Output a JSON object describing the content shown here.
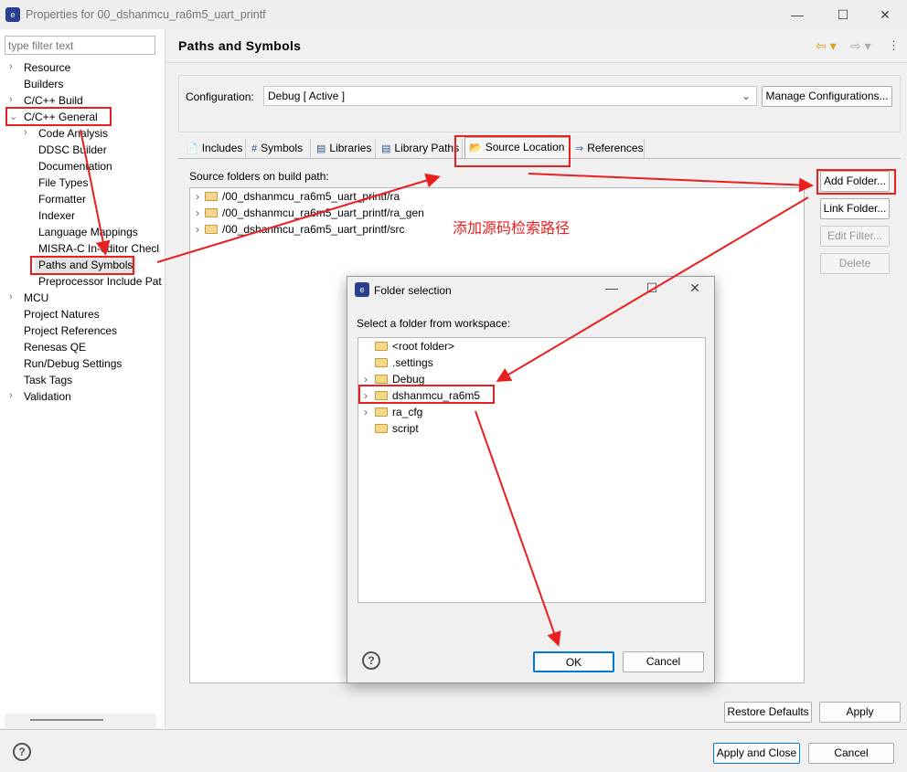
{
  "window": {
    "title": "Properties for 00_dshanmcu_ra6m5_uart_printf",
    "minimize": "—",
    "maximize": "☐",
    "close": "✕"
  },
  "left": {
    "filter_placeholder": "type filter text",
    "tree": [
      {
        "label": "Resource",
        "level": 0,
        "chevron": ">"
      },
      {
        "label": "Builders",
        "level": 0
      },
      {
        "label": "C/C++ Build",
        "level": 0,
        "chevron": ">"
      },
      {
        "label": "C/C++ General",
        "level": 0,
        "chevron": "v"
      },
      {
        "label": "Code Analysis",
        "level": 1,
        "chevron": ">"
      },
      {
        "label": "DDSC Builder",
        "level": 1
      },
      {
        "label": "Documentation",
        "level": 1
      },
      {
        "label": "File Types",
        "level": 1
      },
      {
        "label": "Formatter",
        "level": 1
      },
      {
        "label": "Indexer",
        "level": 1
      },
      {
        "label": "Language Mappings",
        "level": 1
      },
      {
        "label": "MISRA-C In-editor Checl",
        "level": 1
      },
      {
        "label": "Paths and Symbols",
        "level": 1,
        "selected": true
      },
      {
        "label": "Preprocessor Include Pat",
        "level": 1
      },
      {
        "label": "MCU",
        "level": 0,
        "chevron": ">"
      },
      {
        "label": "Project Natures",
        "level": 0
      },
      {
        "label": "Project References",
        "level": 0
      },
      {
        "label": "Renesas QE",
        "level": 0
      },
      {
        "label": "Run/Debug Settings",
        "level": 0
      },
      {
        "label": "Task Tags",
        "level": 0
      },
      {
        "label": "Validation",
        "level": 0,
        "chevron": ">"
      }
    ]
  },
  "page": {
    "title": "Paths and Symbols",
    "config_label": "Configuration:",
    "config_value": "Debug  [ Active ]",
    "manage_button": "Manage Configurations...",
    "tabs": [
      "Includes",
      "Symbols",
      "Libraries",
      "Library Paths",
      "Source Location",
      "References"
    ],
    "active_tab": "Source Location",
    "list_label": "Source folders on build path:",
    "folders": [
      "/00_dshanmcu_ra6m5_uart_printf/ra",
      "/00_dshanmcu_ra6m5_uart_printf/ra_gen",
      "/00_dshanmcu_ra6m5_uart_printf/src"
    ],
    "buttons": {
      "add": "Add Folder...",
      "link": "Link Folder...",
      "edit": "Edit Filter...",
      "delete": "Delete",
      "restore": "Restore Defaults",
      "apply": "Apply"
    },
    "annotation": "添加源码检索路径"
  },
  "footer": {
    "apply_close": "Apply and Close",
    "cancel": "Cancel",
    "help": "?"
  },
  "dialog": {
    "title": "Folder selection",
    "label": "Select a folder from workspace:",
    "items": [
      {
        "label": "<root folder>"
      },
      {
        "label": ".settings"
      },
      {
        "label": "Debug",
        "chevron": ">"
      },
      {
        "label": "dshanmcu_ra6m5",
        "chevron": ">"
      },
      {
        "label": "ra_cfg",
        "chevron": ">"
      },
      {
        "label": "script"
      }
    ],
    "ok": "OK",
    "cancel": "Cancel",
    "help": "?",
    "minimize": "—",
    "maximize": "☐",
    "close": "✕"
  },
  "colors": {
    "annotation": "#e8201f",
    "selection": "#e5e5e5",
    "focus": "#0078d7"
  }
}
